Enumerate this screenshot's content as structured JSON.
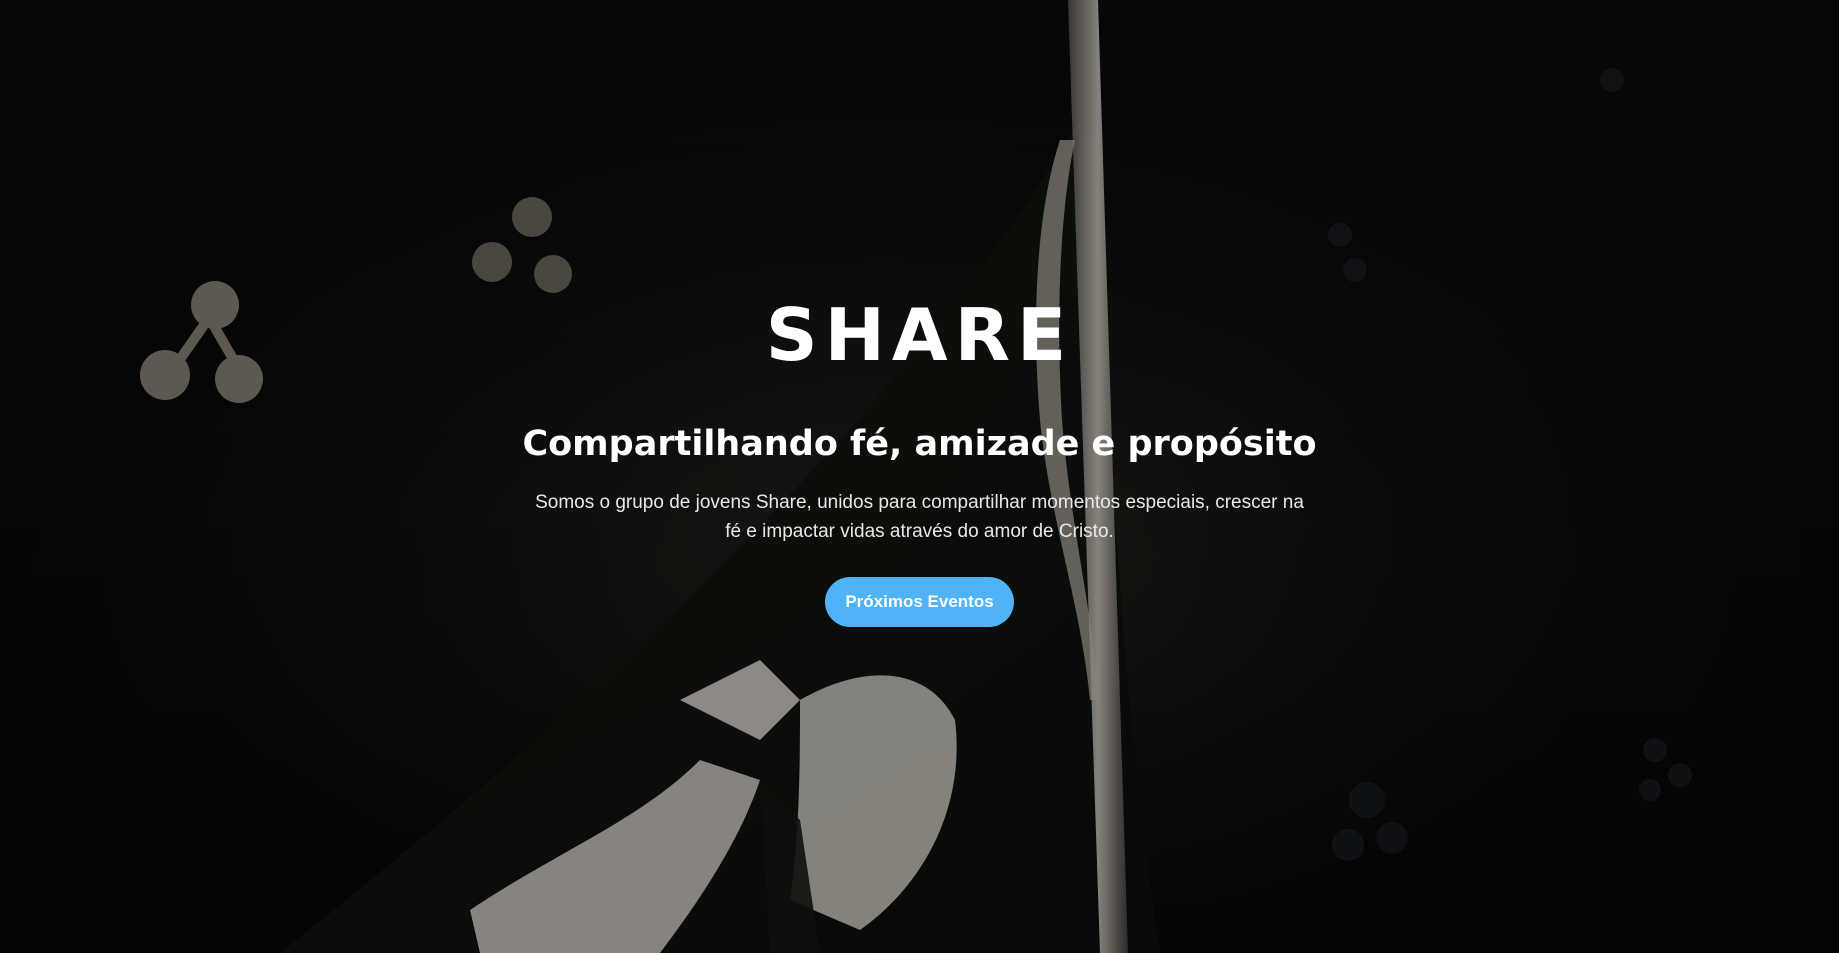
{
  "hero": {
    "title": "SHARE",
    "tagline": "Compartilhando fé, amizade e propósito",
    "description": "Somos o grupo de jovens Share, unidos para compartilhar momentos especiais, crescer na fé e impactar vidas através do amor de Cristo.",
    "cta_label": "Próximos Eventos"
  },
  "colors": {
    "background": "#070707",
    "accent": "#4fb3f5",
    "text": "#ffffff"
  }
}
